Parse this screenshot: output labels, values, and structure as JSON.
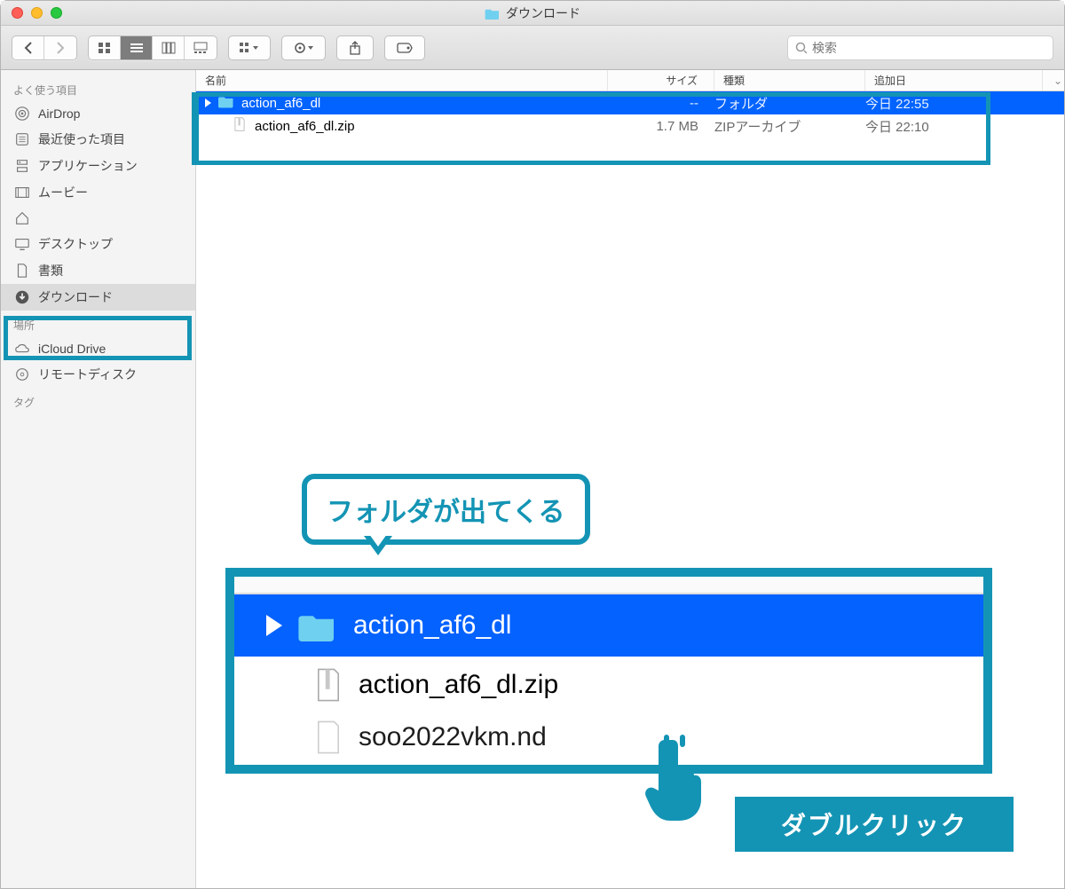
{
  "window": {
    "title": "ダウンロード"
  },
  "search": {
    "placeholder": "検索"
  },
  "sidebar": {
    "section_favorites": "よく使う項目",
    "section_locations": "場所",
    "section_tags": "タグ",
    "items": [
      {
        "label": "AirDrop",
        "icon": "airdrop-icon"
      },
      {
        "label": "最近使った項目",
        "icon": "recents-icon"
      },
      {
        "label": "アプリケーション",
        "icon": "applications-icon"
      },
      {
        "label": "ムービー",
        "icon": "movies-icon"
      },
      {
        "label": "",
        "icon": "home-icon"
      },
      {
        "label": "デスクトップ",
        "icon": "desktop-icon"
      },
      {
        "label": "書類",
        "icon": "documents-icon"
      },
      {
        "label": "ダウンロード",
        "icon": "downloads-icon"
      }
    ],
    "locations": [
      {
        "label": "iCloud Drive",
        "icon": "icloud-icon"
      },
      {
        "label": "リモートディスク",
        "icon": "disc-icon"
      }
    ]
  },
  "columns": {
    "name": "名前",
    "size": "サイズ",
    "kind": "種類",
    "date": "追加日"
  },
  "rows": [
    {
      "name": "action_af6_dl",
      "size": "--",
      "kind": "フォルダ",
      "date": "今日 22:55",
      "type": "folder",
      "selected": true
    },
    {
      "name": "action_af6_dl.zip",
      "size": "1.7 MB",
      "kind": "ZIPアーカイブ",
      "date": "今日 22:10",
      "type": "zip",
      "selected": false
    }
  ],
  "annotations": {
    "callout": "フォルダが出てくる",
    "double_click": "ダブルクリック",
    "zoom_rows": [
      {
        "name": "action_af6_dl",
        "type": "folder",
        "selected": true
      },
      {
        "name": "action_af6_dl.zip",
        "type": "zip",
        "selected": false
      },
      {
        "name": "soo2022vkm.nd",
        "type": "file",
        "selected": false
      }
    ]
  },
  "colors": {
    "annotation": "#1494b4",
    "selection": "#0263ff"
  }
}
